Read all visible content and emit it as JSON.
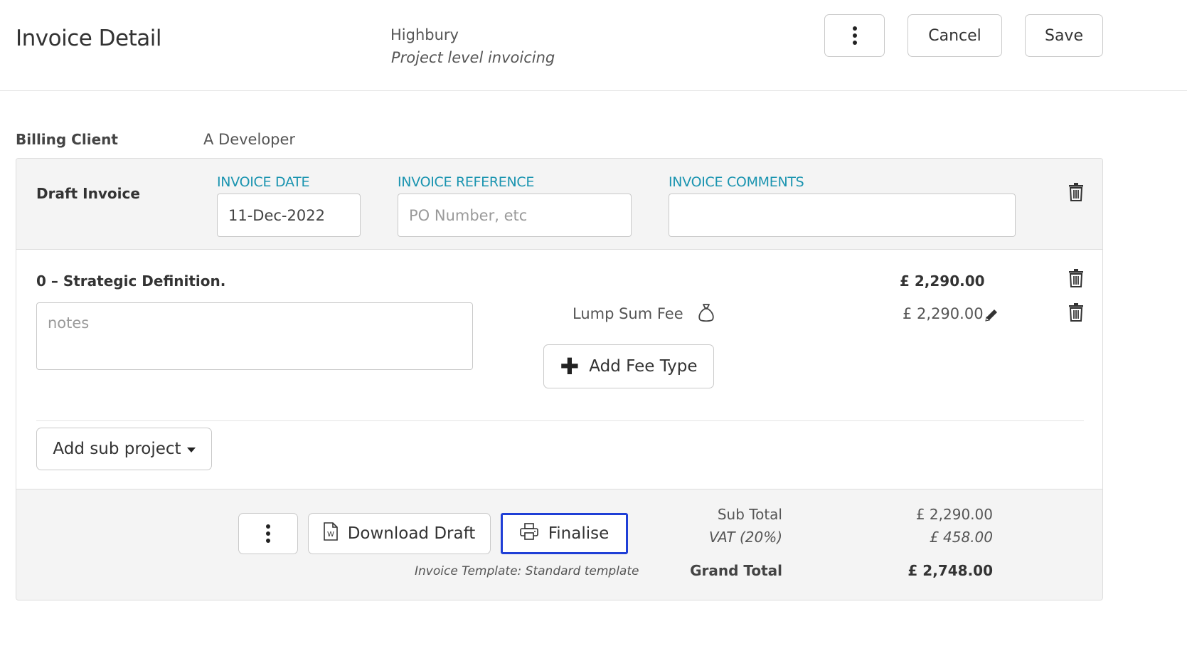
{
  "header": {
    "title": "Invoice Detail",
    "project_name": "Highbury",
    "project_subtitle": "Project level invoicing",
    "cancel_label": "Cancel",
    "save_label": "Save"
  },
  "billing": {
    "label": "Billing Client",
    "value": "A Developer"
  },
  "invoice": {
    "title": "Draft Invoice",
    "date_label": "INVOICE DATE",
    "date_value": "11-Dec-2022",
    "reference_label": "INVOICE REFERENCE",
    "reference_value": "",
    "reference_placeholder": "PO Number, etc",
    "comments_label": "INVOICE COMMENTS",
    "comments_value": ""
  },
  "sub_project": {
    "title": "0 – Strategic Definition.",
    "amount": "£ 2,290.00",
    "notes_placeholder": "notes",
    "fee": {
      "label": "Lump Sum Fee",
      "amount": "£ 2,290.00",
      "icon": "money-bag-icon"
    },
    "add_fee_label": "Add Fee Type",
    "add_sub_project_label": "Add sub project"
  },
  "footer": {
    "download_label": "Download Draft",
    "finalise_label": "Finalise",
    "template_note": "Invoice Template: Standard template",
    "finalise_border_color": "#1f3fd6"
  },
  "totals": {
    "subtotal_label": "Sub Total",
    "subtotal_value": "£ 2,290.00",
    "vat_label": "VAT (20%)",
    "vat_value": "£ 458.00",
    "grand_total_label": "Grand Total",
    "grand_total_value": "£ 2,748.00"
  },
  "colors": {
    "field_label": "#1a94b0",
    "panel_background": "#f4f4f4"
  }
}
